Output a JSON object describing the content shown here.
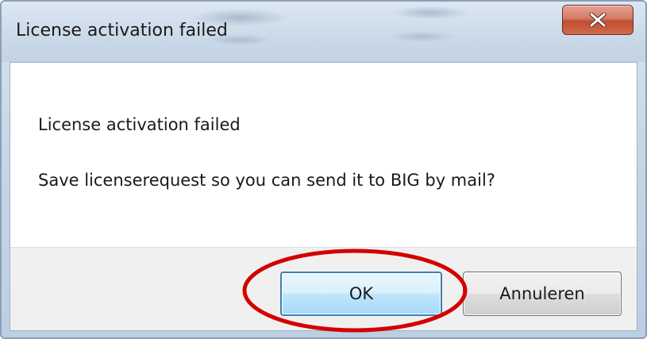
{
  "window": {
    "title": "License activation failed",
    "close_icon": "close-x-icon"
  },
  "message": {
    "heading": "License activation failed",
    "question": "Save licenserequest so you can send it to BIG by mail?"
  },
  "buttons": {
    "ok_label": "OK",
    "cancel_label": "Annuleren"
  },
  "colors": {
    "close_button": "#c24e33",
    "ok_border": "#3c7fb1",
    "annotation": "#d40000"
  }
}
